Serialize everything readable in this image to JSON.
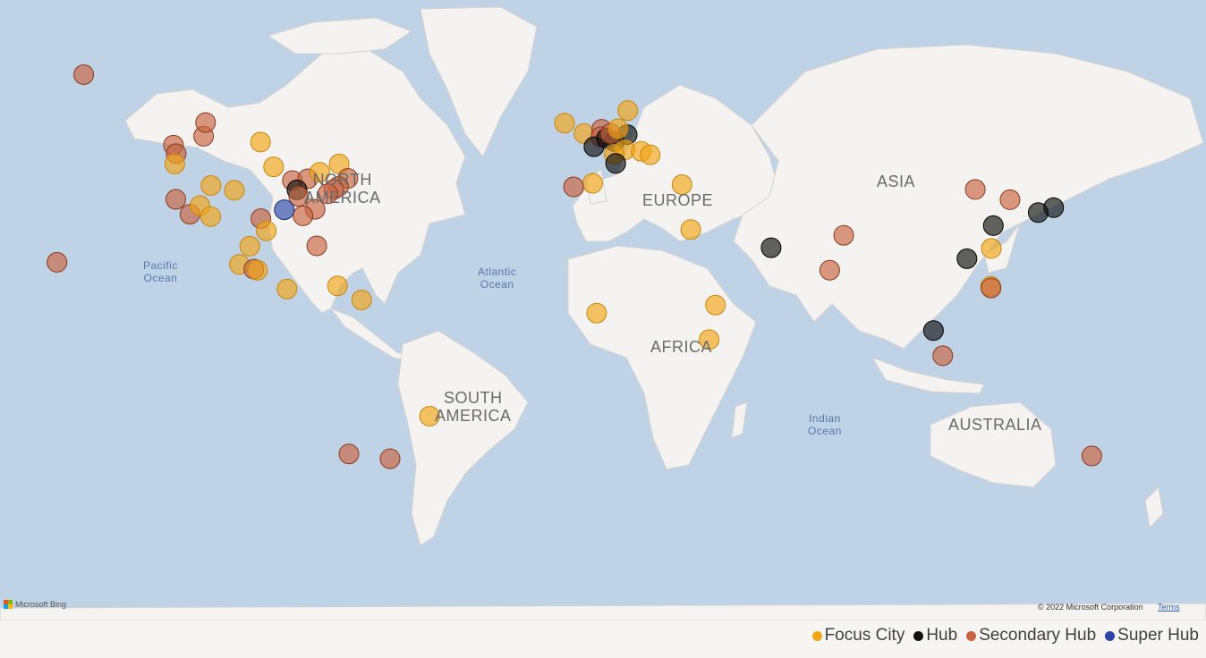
{
  "map": {
    "continent_labels": {
      "north_america": [
        "NORTH",
        "AMERICA"
      ],
      "south_america": [
        "SOUTH",
        "AMERICA"
      ],
      "europe": "EUROPE",
      "africa": "AFRICA",
      "asia": "ASIA",
      "australia": "AUSTRALIA"
    },
    "ocean_labels": {
      "pacific": [
        "Pacific",
        "Ocean"
      ],
      "atlantic": [
        "Atlantic",
        "Ocean"
      ],
      "indian": [
        "Indian",
        "Ocean"
      ]
    },
    "attribution": {
      "brand": "Microsoft Bing",
      "copyright": "© 2022 Microsoft Corporation",
      "terms": "Terms"
    }
  },
  "legend": [
    {
      "label": "Focus City",
      "color": "#f2a516"
    },
    {
      "label": "Hub",
      "color": "#111111"
    },
    {
      "label": "Secondary Hub",
      "color": "#c8643f"
    },
    {
      "label": "Super Hub",
      "color": "#2b45a8"
    }
  ],
  "colors": {
    "ocean": "#c0d2e5",
    "land": "#f4f3f1",
    "focus_city": "#f2a516",
    "hub": "#111111",
    "secondary_hub": "#c8643f",
    "super_hub": "#2b45a8"
  },
  "chart_data": {
    "type": "scatter",
    "projection": "web-mercator",
    "encoding": "bubble category by color",
    "points": [
      {
        "lat": 61.2,
        "lon": -149.9,
        "category": "Secondary Hub"
      },
      {
        "lat": 21.3,
        "lon": -157.9,
        "category": "Secondary Hub"
      },
      {
        "lat": 49.3,
        "lon": -123.1,
        "category": "Secondary Hub"
      },
      {
        "lat": 47.6,
        "lon": -122.3,
        "category": "Secondary Hub"
      },
      {
        "lat": 51.0,
        "lon": -114.1,
        "category": "Secondary Hub"
      },
      {
        "lat": 53.5,
        "lon": -113.5,
        "category": "Secondary Hub"
      },
      {
        "lat": 45.5,
        "lon": -122.7,
        "category": "Focus City"
      },
      {
        "lat": 37.6,
        "lon": -122.4,
        "category": "Secondary Hub"
      },
      {
        "lat": 34.0,
        "lon": -118.2,
        "category": "Secondary Hub"
      },
      {
        "lat": 36.1,
        "lon": -115.2,
        "category": "Focus City"
      },
      {
        "lat": 40.8,
        "lon": -111.9,
        "category": "Focus City"
      },
      {
        "lat": 33.4,
        "lon": -112.0,
        "category": "Focus City"
      },
      {
        "lat": 39.7,
        "lon": -104.9,
        "category": "Focus City"
      },
      {
        "lat": 49.9,
        "lon": -97.1,
        "category": "Focus City"
      },
      {
        "lat": 44.9,
        "lon": -93.2,
        "category": "Focus City"
      },
      {
        "lat": 41.9,
        "lon": -87.6,
        "category": "Secondary Hub"
      },
      {
        "lat": 42.3,
        "lon": -83.0,
        "category": "Secondary Hub"
      },
      {
        "lat": 43.7,
        "lon": -79.4,
        "category": "Focus City"
      },
      {
        "lat": 45.5,
        "lon": -73.6,
        "category": "Focus City"
      },
      {
        "lat": 42.4,
        "lon": -71.0,
        "category": "Secondary Hub"
      },
      {
        "lat": 40.6,
        "lon": -73.8,
        "category": "Secondary Hub"
      },
      {
        "lat": 39.9,
        "lon": -75.2,
        "category": "Secondary Hub"
      },
      {
        "lat": 38.9,
        "lon": -77.0,
        "category": "Secondary Hub"
      },
      {
        "lat": 35.2,
        "lon": -80.8,
        "category": "Secondary Hub"
      },
      {
        "lat": 33.6,
        "lon": -84.4,
        "category": "Secondary Hub"
      },
      {
        "lat": 39.8,
        "lon": -86.2,
        "category": "Hub"
      },
      {
        "lat": 38.3,
        "lon": -85.7,
        "category": "Secondary Hub"
      },
      {
        "lat": 35.1,
        "lon": -90.0,
        "category": "Super Hub"
      },
      {
        "lat": 32.9,
        "lon": -97.0,
        "category": "Secondary Hub"
      },
      {
        "lat": 29.8,
        "lon": -95.4,
        "category": "Focus City"
      },
      {
        "lat": 25.8,
        "lon": -80.3,
        "category": "Secondary Hub"
      },
      {
        "lat": 25.7,
        "lon": -100.3,
        "category": "Focus City"
      },
      {
        "lat": 20.7,
        "lon": -103.4,
        "category": "Focus City"
      },
      {
        "lat": 19.4,
        "lon": -99.1,
        "category": "Secondary Hub"
      },
      {
        "lat": 19.1,
        "lon": -98.0,
        "category": "Focus City"
      },
      {
        "lat": 13.7,
        "lon": -89.2,
        "category": "Focus City"
      },
      {
        "lat": 14.6,
        "lon": -74.1,
        "category": "Focus City"
      },
      {
        "lat": 10.5,
        "lon": -66.9,
        "category": "Focus City"
      },
      {
        "lat": -23.5,
        "lon": -46.6,
        "category": "Focus City"
      },
      {
        "lat": -33.4,
        "lon": -70.7,
        "category": "Secondary Hub"
      },
      {
        "lat": -34.6,
        "lon": -58.4,
        "category": "Secondary Hub"
      },
      {
        "lat": 53.4,
        "lon": -6.3,
        "category": "Focus City"
      },
      {
        "lat": 51.5,
        "lon": -0.5,
        "category": "Focus City"
      },
      {
        "lat": 52.3,
        "lon": 4.8,
        "category": "Secondary Hub"
      },
      {
        "lat": 50.9,
        "lon": 4.5,
        "category": "Secondary Hub"
      },
      {
        "lat": 49.0,
        "lon": 2.5,
        "category": "Hub"
      },
      {
        "lat": 50.6,
        "lon": 6.2,
        "category": "Hub"
      },
      {
        "lat": 50.0,
        "lon": 8.6,
        "category": "Hub"
      },
      {
        "lat": 51.3,
        "lon": 12.4,
        "category": "Hub"
      },
      {
        "lat": 51.5,
        "lon": 7.5,
        "category": "Secondary Hub"
      },
      {
        "lat": 52.4,
        "lon": 9.7,
        "category": "Focus City"
      },
      {
        "lat": 55.6,
        "lon": 12.6,
        "category": "Focus City"
      },
      {
        "lat": 48.4,
        "lon": 11.8,
        "category": "Focus City"
      },
      {
        "lat": 47.5,
        "lon": 8.5,
        "category": "Focus City"
      },
      {
        "lat": 48.1,
        "lon": 16.6,
        "category": "Focus City"
      },
      {
        "lat": 47.4,
        "lon": 19.3,
        "category": "Focus City"
      },
      {
        "lat": 45.6,
        "lon": 9.0,
        "category": "Hub"
      },
      {
        "lat": 41.3,
        "lon": 2.1,
        "category": "Focus City"
      },
      {
        "lat": 40.5,
        "lon": -3.6,
        "category": "Secondary Hub"
      },
      {
        "lat": 41.0,
        "lon": 28.8,
        "category": "Focus City"
      },
      {
        "lat": 30.1,
        "lon": 31.4,
        "category": "Focus City"
      },
      {
        "lat": 25.3,
        "lon": 55.4,
        "category": "Hub"
      },
      {
        "lat": 9.0,
        "lon": 38.8,
        "category": "Focus City"
      },
      {
        "lat": -1.3,
        "lon": 36.9,
        "category": "Focus City"
      },
      {
        "lat": 6.6,
        "lon": 3.3,
        "category": "Focus City"
      },
      {
        "lat": 28.6,
        "lon": 77.1,
        "category": "Secondary Hub"
      },
      {
        "lat": 19.1,
        "lon": 72.9,
        "category": "Secondary Hub"
      },
      {
        "lat": 1.4,
        "lon": 103.9,
        "category": "Hub"
      },
      {
        "lat": -6.1,
        "lon": 106.7,
        "category": "Secondary Hub"
      },
      {
        "lat": 22.3,
        "lon": 113.9,
        "category": "Hub"
      },
      {
        "lat": 31.1,
        "lon": 121.8,
        "category": "Hub"
      },
      {
        "lat": 39.9,
        "lon": 116.4,
        "category": "Secondary Hub"
      },
      {
        "lat": 37.5,
        "lon": 126.8,
        "category": "Secondary Hub"
      },
      {
        "lat": 35.6,
        "lon": 139.8,
        "category": "Hub"
      },
      {
        "lat": 34.4,
        "lon": 135.2,
        "category": "Hub"
      },
      {
        "lat": 25.1,
        "lon": 121.2,
        "category": "Focus City"
      },
      {
        "lat": 14.5,
        "lon": 121.0,
        "category": "Focus City"
      },
      {
        "lat": 14.0,
        "lon": 121.1,
        "category": "Secondary Hub"
      },
      {
        "lat": -33.9,
        "lon": 151.2,
        "category": "Secondary Hub"
      }
    ]
  }
}
